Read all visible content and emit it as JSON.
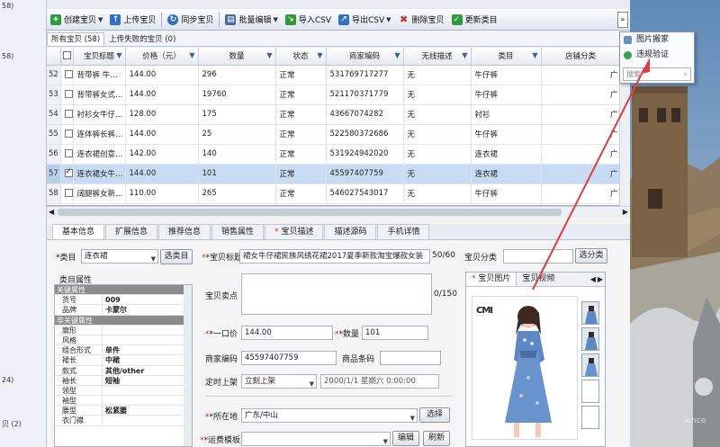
{
  "left_strip": {
    "items": [
      "58)",
      "58)",
      "24)",
      "贝 (2)"
    ]
  },
  "toolbar": {
    "buttons": [
      {
        "label": "创建宝贝",
        "icon": "plus-icon",
        "color": "#2f9a3a"
      },
      {
        "label": "上传宝贝",
        "icon": "upload-icon",
        "color": "#2f6fc7"
      },
      {
        "label": "同步宝贝",
        "icon": "sync-icon",
        "color": "#2f6fc7"
      },
      {
        "label": "批量编辑",
        "icon": "batch-edit-icon",
        "color": "#4a6a9a"
      },
      {
        "label": "导入CSV",
        "icon": "import-csv-icon",
        "color": "#2f9a3a"
      },
      {
        "label": "导出CSV",
        "icon": "export-csv-icon",
        "color": "#2f6fc7"
      },
      {
        "label": "删除宝贝",
        "icon": "delete-icon",
        "color": "#d23030"
      },
      {
        "label": "更新类目",
        "icon": "update-icon",
        "color": "#2f9a3a"
      }
    ],
    "more": "»"
  },
  "list_tabs": [
    "所有宝贝 (58)",
    "上传失败的宝贝 (0)"
  ],
  "grid": {
    "columns": [
      "宝贝标题",
      "价格（元）",
      "数量",
      "状态",
      "商家编码",
      "无线描述",
      "类目",
      "店铺分类"
    ],
    "rows": [
      {
        "n": "52",
        "title": "背带裤 牛…",
        "price": "144.00",
        "qty": "296",
        "status": "正常",
        "code": "531769717277",
        "wireless": "无",
        "cat": "牛仔裤",
        "shop": "广"
      },
      {
        "n": "53",
        "title": "背带裤女式…",
        "price": "144.00",
        "qty": "19760",
        "status": "正常",
        "code": "521170371779",
        "wireless": "无",
        "cat": "牛仔裤",
        "shop": "广"
      },
      {
        "n": "54",
        "title": "衬衫女牛仔…",
        "price": "128.00",
        "qty": "175",
        "status": "正常",
        "code": "43667074282",
        "wireless": "无",
        "cat": "衬衫",
        "shop": "广"
      },
      {
        "n": "55",
        "title": "连体裤长裤…",
        "price": "144.00",
        "qty": "25",
        "status": "正常",
        "code": "522580372686",
        "wireless": "无",
        "cat": "牛仔裤",
        "shop": "广"
      },
      {
        "n": "56",
        "title": "连衣裙创意…",
        "price": "142.00",
        "qty": "140",
        "status": "正常",
        "code": "531924942020",
        "wireless": "无",
        "cat": "连衣裙",
        "shop": "广"
      },
      {
        "n": "57",
        "title": "连衣裙女牛…",
        "price": "144.00",
        "qty": "101",
        "status": "正常",
        "code": "45597407759",
        "wireless": "无",
        "cat": "连衣裙",
        "shop": "广"
      },
      {
        "n": "58",
        "title": "阔腿裤女新…",
        "price": "110.00",
        "qty": "265",
        "status": "正常",
        "code": "546027543017",
        "wireless": "无",
        "cat": "牛仔裤",
        "shop": "广"
      }
    ]
  },
  "detail_tabs": [
    "基本信息",
    "扩展信息",
    "推荐信息",
    "销售属性",
    "宝贝描述",
    "描述源码",
    "手机详情"
  ],
  "detail": {
    "category_label": "*类目",
    "category_value": "连衣裙",
    "category_button": "选类目",
    "title_label": "*宝贝标题",
    "title_value": "裙女牛仔裙民族风绣花裙2017夏季新款淘宝爆款女装",
    "title_count": "50/60",
    "shop_cat_label": "宝贝分类",
    "shop_cat_button": "选分类",
    "props_title": "类目属性",
    "selling_label": "宝贝卖点",
    "selling_count": "0/150",
    "price_label": "*一口价",
    "price_value": "144.00",
    "qty_label": "*数量",
    "qty_value": "101",
    "code_label": "商家编码",
    "code_value": "45597407759",
    "barcode_label": "商品条码",
    "schedule_label": "定时上架",
    "schedule_value": "立刻上架",
    "schedule_date": "2000/1/1 星期六 0:00:00",
    "location_label": "*所在地",
    "location_value": "广东/中山",
    "location_button": "选择",
    "shipping_label": "*运费模板",
    "shipping_edit": "编辑",
    "shipping_refresh": "刷新"
  },
  "props": [
    {
      "type": "sec",
      "name": "关键属性"
    },
    {
      "name": "货号",
      "value": "009"
    },
    {
      "name": "品牌",
      "value": "卡蒙尔"
    },
    {
      "type": "sec",
      "name": "非关键属性"
    },
    {
      "name": "廓形",
      "value": ""
    },
    {
      "name": "风格",
      "value": ""
    },
    {
      "name": "组合形式",
      "value": "单件"
    },
    {
      "name": "裙长",
      "value": "中裙"
    },
    {
      "name": "款式",
      "value": "其他/other"
    },
    {
      "name": "袖长",
      "value": "短袖"
    },
    {
      "name": "领型",
      "value": ""
    },
    {
      "name": "袖型",
      "value": ""
    },
    {
      "name": "腰型",
      "value": "松紧腰"
    },
    {
      "name": "衣门襟",
      "value": ""
    }
  ],
  "image_panel": {
    "tabs": [
      "宝贝图片",
      "宝贝视频"
    ],
    "logo_text": "CMI"
  },
  "menu": {
    "items": [
      "图片搬家",
      "违规验证"
    ],
    "search_placeholder": "搜索"
  },
  "colors": {
    "selection": "#c7dcf4",
    "toolbar": "#dfe6f0",
    "arrow": "#e23b3b"
  }
}
